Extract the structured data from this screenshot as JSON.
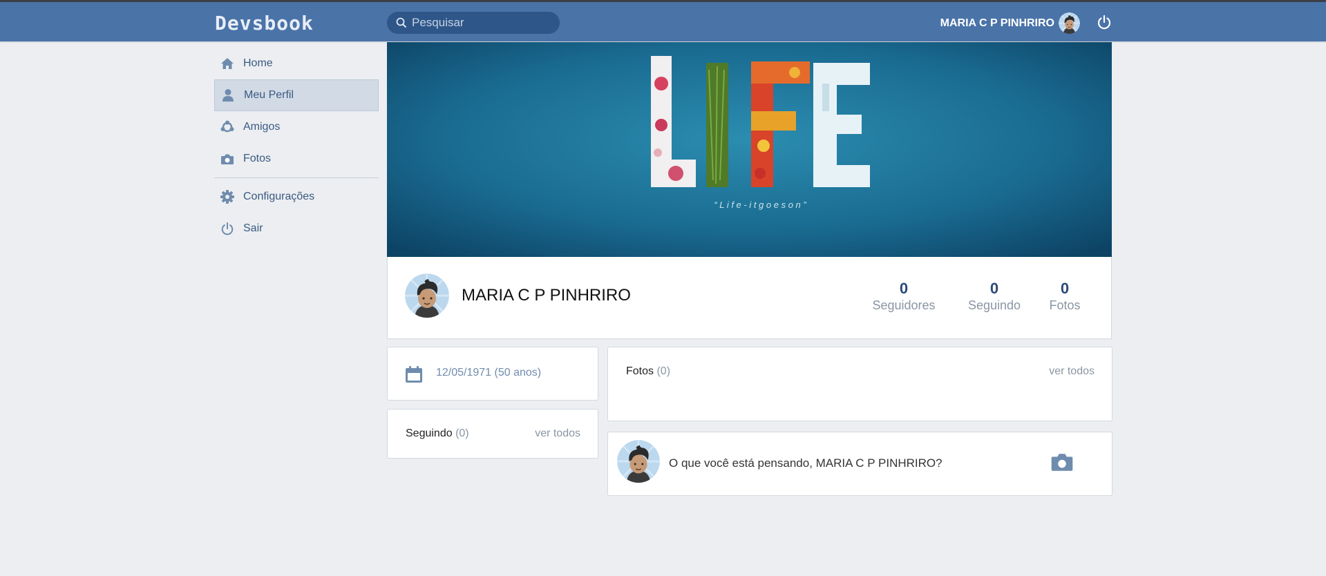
{
  "header": {
    "logo": "Devsbook",
    "search_placeholder": "Pesquisar",
    "user_name": "MARIA C P PINHRIRO"
  },
  "sidebar": {
    "items": [
      {
        "label": "Home",
        "icon": "home-icon"
      },
      {
        "label": "Meu Perfil",
        "icon": "user-icon",
        "active": true
      },
      {
        "label": "Amigos",
        "icon": "friends-icon"
      },
      {
        "label": "Fotos",
        "icon": "camera-icon"
      },
      {
        "label": "Configurações",
        "icon": "gear-icon"
      },
      {
        "label": "Sair",
        "icon": "power-icon"
      }
    ]
  },
  "cover": {
    "title": "LIFE",
    "caption": "“ L i f e  -  i t  g o e s  o n ”"
  },
  "profile": {
    "name": "MARIA C P PINHRIRO",
    "stats": [
      {
        "value": "0",
        "label": "Seguidores"
      },
      {
        "value": "0",
        "label": "Seguindo"
      },
      {
        "value": "0",
        "label": "Fotos"
      }
    ]
  },
  "birthday": {
    "text": "12/05/1971 (50 anos)"
  },
  "following_card": {
    "title": "Seguindo",
    "count": "(0)",
    "link": "ver todos"
  },
  "photos_card": {
    "title": "Fotos",
    "count": "(0)",
    "link": "ver todos"
  },
  "post_box": {
    "prompt": "O que você está pensando, MARIA C P PINHRIRO?"
  },
  "colors": {
    "topbar": "#4a73a8",
    "search_bg": "#2f5688",
    "page_bg": "#eceef1",
    "link_blue": "#3a5a82",
    "stat_number": "#2c4a78"
  }
}
